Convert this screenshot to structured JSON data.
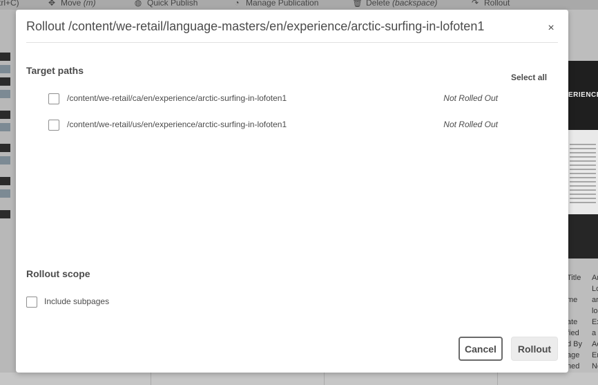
{
  "toolbar": {
    "items": [
      {
        "label": "trl+C)",
        "icon": "copy-icon"
      },
      {
        "label": "Move ",
        "shortcut": "(m)",
        "icon": "move-icon"
      },
      {
        "label": "Quick Publish",
        "icon": "globe-icon"
      },
      {
        "label": "Manage Publication",
        "icon": "manage-publication-icon"
      },
      {
        "label": "Delete ",
        "shortcut": "(backspace)",
        "icon": "trash-icon"
      },
      {
        "label": "Rollout",
        "icon": "rollout-icon"
      }
    ]
  },
  "properties": {
    "labels": [
      "Title",
      "",
      "me",
      "",
      "ate",
      "fied",
      "d By",
      "age",
      "ned"
    ],
    "values": [
      "Ar",
      "Lo",
      "ar",
      "lo",
      "Ex",
      "a",
      "Ac",
      "Er",
      "No"
    ]
  },
  "preview": {
    "hero_text": "ERIENCE"
  },
  "dialog": {
    "title": "Rollout /content/we-retail/language-masters/en/experience/arctic-surfing-in-lofoten1",
    "close_icon": "×",
    "target_paths_heading": "Target paths",
    "select_all_label": "Select all",
    "target_paths": [
      {
        "path": "/content/we-retail/ca/en/experience/arctic-surfing-in-lofoten1",
        "status": "Not Rolled Out",
        "checked": false
      },
      {
        "path": "/content/we-retail/us/en/experience/arctic-surfing-in-lofoten1",
        "status": "Not Rolled Out",
        "checked": false
      }
    ],
    "rollout_scope_heading": "Rollout scope",
    "include_subpages_label": "Include subpages",
    "include_subpages_checked": false,
    "cancel_label": "Cancel",
    "rollout_label": "Rollout"
  }
}
